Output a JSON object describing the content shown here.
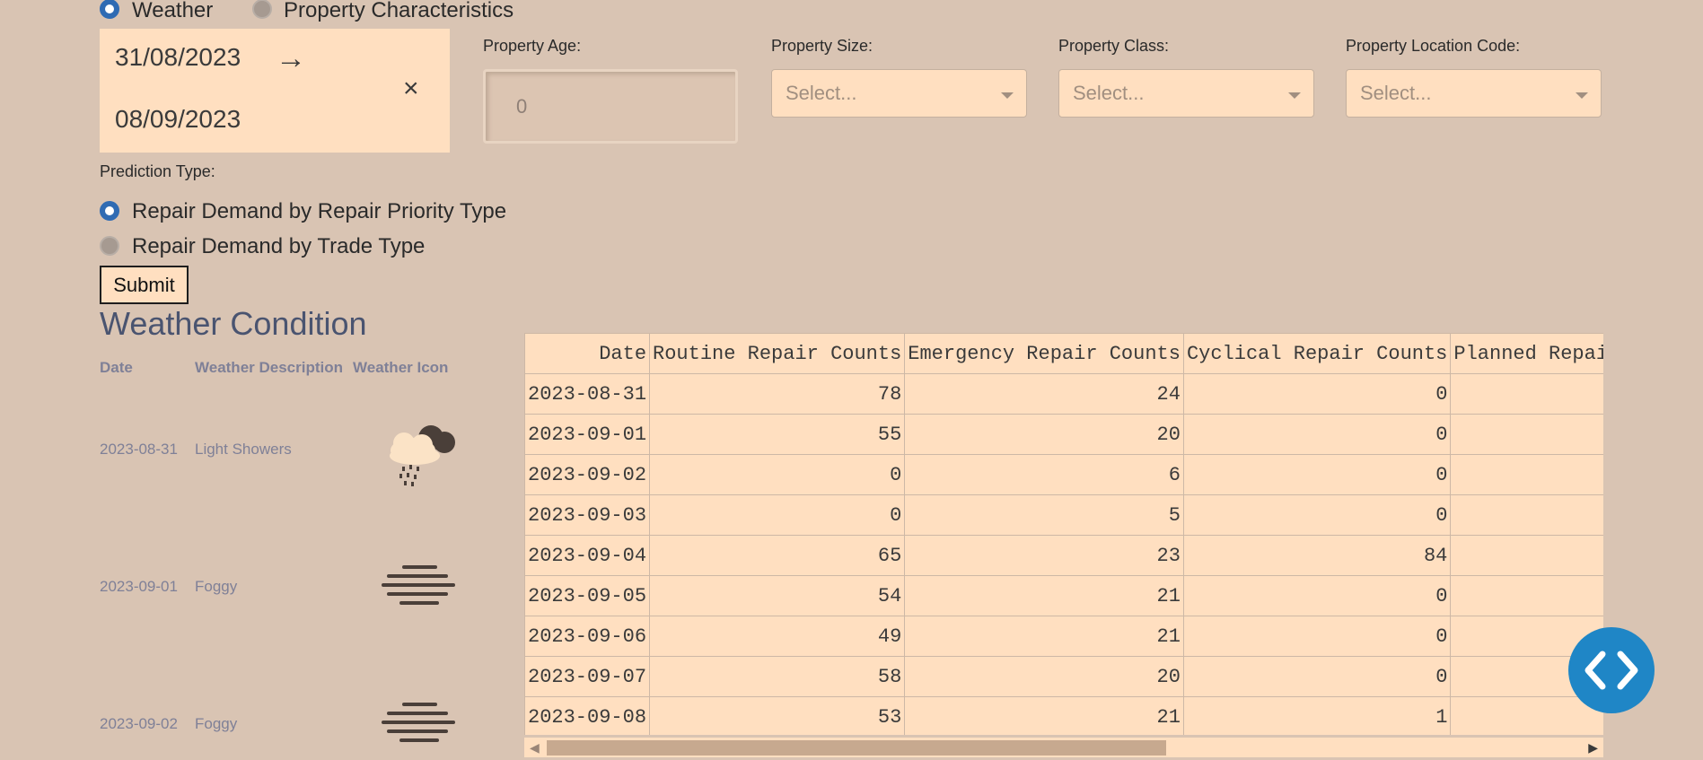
{
  "view_toggle": {
    "options": [
      {
        "label": "Weather",
        "selected": true
      },
      {
        "label": "Property Characteristics",
        "selected": false
      }
    ]
  },
  "date_range": {
    "start": "31/08/2023",
    "end": "08/09/2023",
    "arrow_icon": "→",
    "clear_icon": "×"
  },
  "filters": {
    "age_label": "Property Age:",
    "age_value": "0",
    "size_label": "Property Size:",
    "size_placeholder": "Select...",
    "class_label": "Property Class:",
    "class_placeholder": "Select...",
    "location_label": "Property Location Code:",
    "location_placeholder": "Select..."
  },
  "prediction": {
    "label": "Prediction Type:",
    "options": [
      {
        "label": "Repair Demand by Repair Priority Type",
        "selected": true
      },
      {
        "label": "Repair Demand by Trade Type",
        "selected": false
      }
    ]
  },
  "submit_label": "Submit",
  "weather": {
    "title": "Weather Condition",
    "headers": {
      "date": "Date",
      "description": "Weather Description",
      "icon": "Weather Icon"
    },
    "rows": [
      {
        "date": "2023-08-31",
        "description": "Light Showers",
        "icon": "rain-cloud-icon"
      },
      {
        "date": "2023-09-01",
        "description": "Foggy",
        "icon": "fog-icon"
      },
      {
        "date": "2023-09-02",
        "description": "Foggy",
        "icon": "fog-icon"
      }
    ]
  },
  "table": {
    "headers": [
      "Date",
      "Routine Repair Counts",
      "Emergency Repair Counts",
      "Cyclical Repair Counts",
      "Planned Repai"
    ],
    "rows": [
      [
        "2023-08-31",
        "78",
        "24",
        "0",
        ""
      ],
      [
        "2023-09-01",
        "55",
        "20",
        "0",
        ""
      ],
      [
        "2023-09-02",
        "0",
        "6",
        "0",
        ""
      ],
      [
        "2023-09-03",
        "0",
        "5",
        "0",
        ""
      ],
      [
        "2023-09-04",
        "65",
        "23",
        "84",
        ""
      ],
      [
        "2023-09-05",
        "54",
        "21",
        "0",
        ""
      ],
      [
        "2023-09-06",
        "49",
        "21",
        "0",
        ""
      ],
      [
        "2023-09-07",
        "58",
        "20",
        "0",
        ""
      ],
      [
        "2023-09-08",
        "53",
        "21",
        "1",
        ""
      ]
    ]
  },
  "colors": {
    "background": "#d9c4b3",
    "panel": "#ffdfc0",
    "accent_blue": "#2f6bb3",
    "code_button": "#1f86c6",
    "title": "#4a5470"
  }
}
